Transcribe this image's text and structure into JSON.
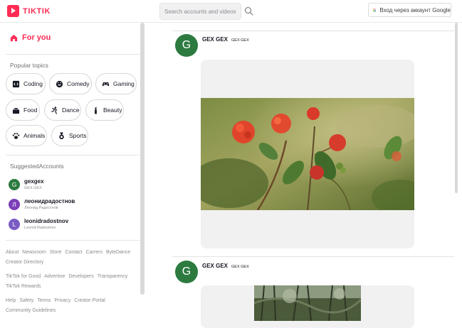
{
  "header": {
    "logo_text": "TIKTIK",
    "search_placeholder": "Search accounts and videos",
    "google_label": "Вход через аккаунт Google"
  },
  "sidebar": {
    "for_you": "For you",
    "popular_topics_title": "Popular topics",
    "topics": [
      {
        "label": "Coding",
        "icon": "code-icon"
      },
      {
        "label": "Comedy",
        "icon": "comedy-icon"
      },
      {
        "label": "Gaming",
        "icon": "gamepad-icon"
      },
      {
        "label": "Food",
        "icon": "food-icon"
      },
      {
        "label": "Dance",
        "icon": "dance-icon"
      },
      {
        "label": "Beauty",
        "icon": "beauty-icon"
      },
      {
        "label": "Animals",
        "icon": "paw-icon"
      },
      {
        "label": "Sports",
        "icon": "medal-icon"
      }
    ],
    "suggested_title": "SuggestedAccounts",
    "accounts": [
      {
        "initial": "G",
        "name": "gexgex",
        "sub": "GEX GEX",
        "color": "#2c7a3f"
      },
      {
        "initial": "Л",
        "name": "леонидрадостнов",
        "sub": "Леонид Радостнов",
        "color": "#7b3fb8"
      },
      {
        "initial": "L",
        "name": "leonidradostnov",
        "sub": "Leonid Radostnov",
        "color": "#7b5cc4"
      }
    ],
    "footer": {
      "row1": [
        "About",
        "Newsroom",
        "Store",
        "Contact",
        "Carrers",
        "ByteDance",
        "Creator Directory"
      ],
      "row2": [
        "TikTok for Good",
        "Advertise",
        "Developers",
        "Transparency",
        "TikTok Rewards"
      ],
      "row3": [
        "Help",
        "Safety",
        "Terms",
        "Privacy",
        "Creator Portal",
        "Community Guidelines"
      ]
    }
  },
  "feed": {
    "posts": [
      {
        "initial": "G",
        "author": "GEX GEX",
        "author_sub": "GEX GEX"
      },
      {
        "initial": "G",
        "author": "GEX GEX",
        "author_sub": "GEX GEX"
      }
    ]
  },
  "colors": {
    "brand": "#fe2c55",
    "avatar_green": "#2c7a3f"
  }
}
